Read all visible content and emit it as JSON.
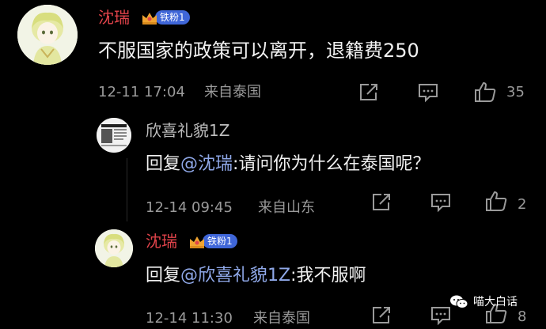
{
  "comments": [
    {
      "username": "沈瑞",
      "badge": "铁粉1",
      "content": "不服国家的政策可以离开，退籍费250",
      "time": "12-11 17:04",
      "location": "来自泰国",
      "likes": "35"
    }
  ],
  "replies": [
    {
      "username": "欣喜礼貌1Z",
      "reply_prefix": "回复",
      "reply_to": "@沈瑞",
      "content": ":请问你为什么在泰国呢？",
      "time": "12-14 09:45",
      "location": "来自山东",
      "likes": "2"
    },
    {
      "username": "沈瑞",
      "badge": "铁粉1",
      "reply_prefix": "回复",
      "reply_to": "@欣喜礼貌1Z",
      "content": ":我不服啊",
      "time": "12-14 11:30",
      "location": "来自泰国",
      "likes": "8"
    }
  ],
  "watermark": {
    "text": "喵大白话"
  },
  "colors": {
    "username": "#e0434a",
    "mention": "#8fa8e8",
    "badge": "#3f66d8",
    "background": "#000000"
  }
}
